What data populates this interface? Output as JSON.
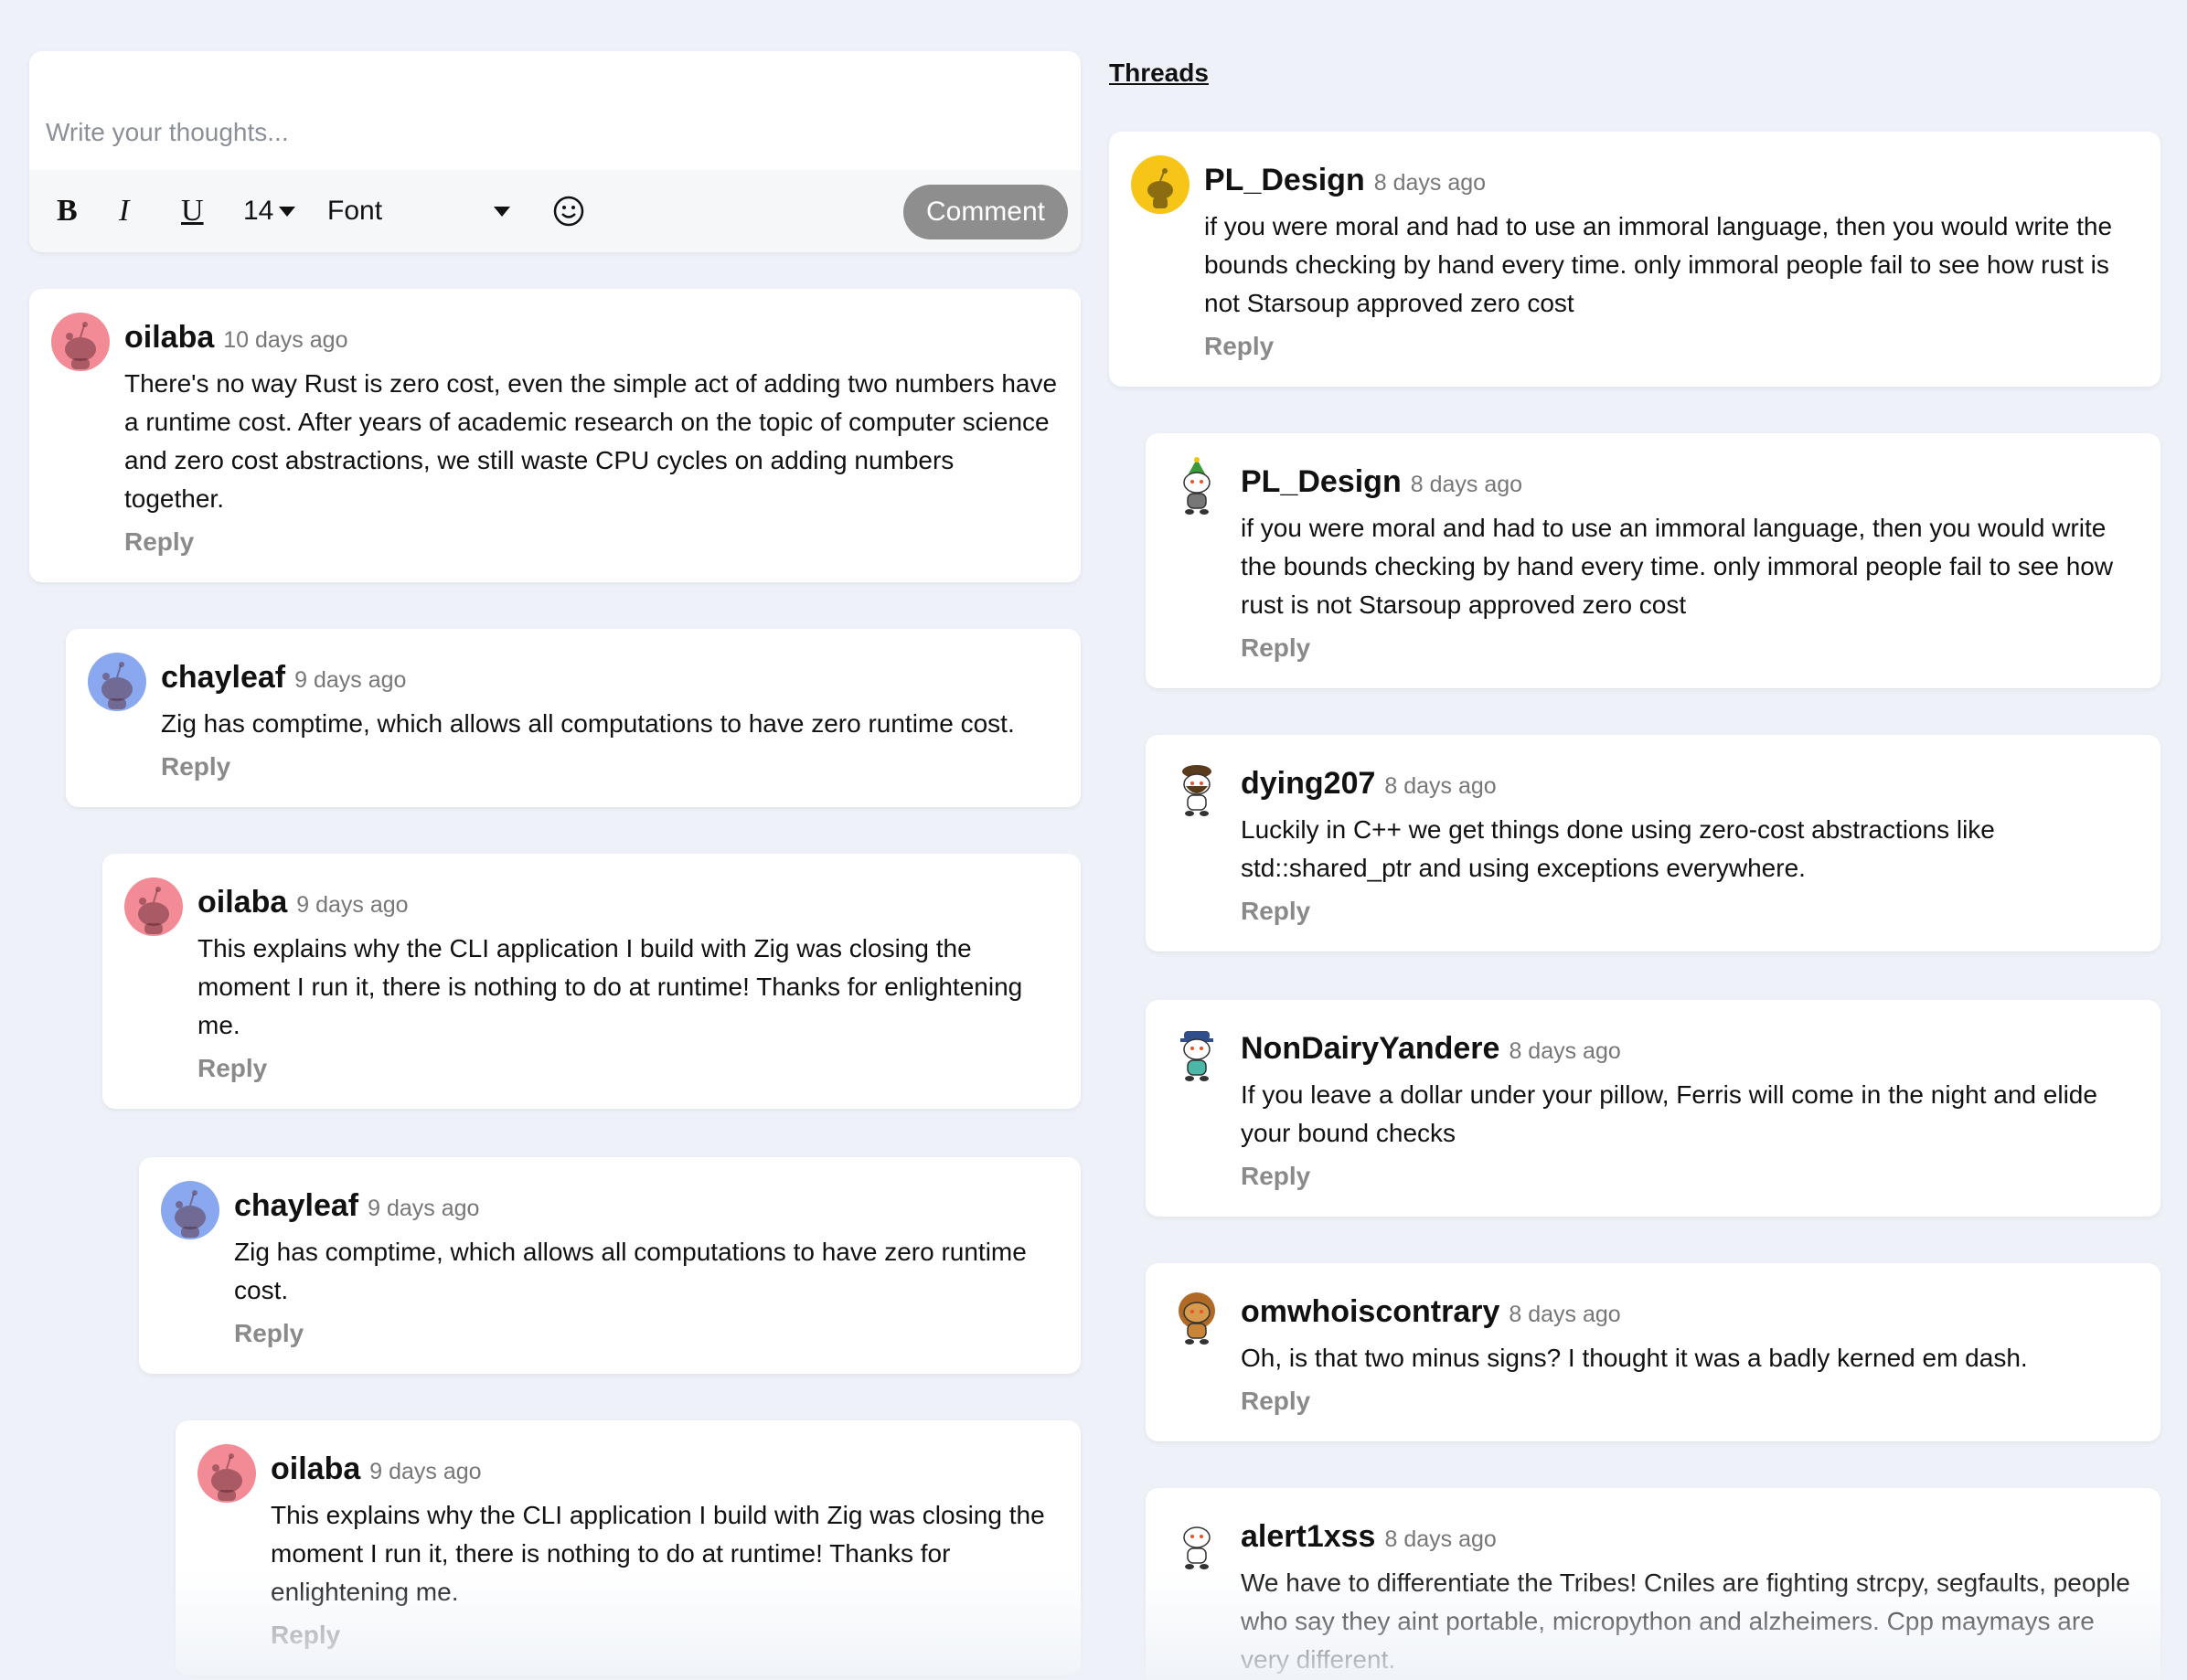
{
  "editor": {
    "placeholder": "Write your thoughts...",
    "bold_label": "B",
    "italic_label": "I",
    "underline_label": "U",
    "font_size": "14",
    "font_label": "Font",
    "comment_label": "Comment"
  },
  "comments": [
    {
      "user": "oilaba",
      "time": "10 days ago",
      "text": "There's no way Rust is zero cost, even the simple act of adding two numbers have a runtime cost. After years of academic research on the topic of computer science and zero cost abstractions, we still waste CPU cycles on adding numbers together.",
      "reply": "Reply",
      "avatar_color": "#f28b95"
    },
    {
      "user": "chayleaf",
      "time": "9 days ago",
      "text": "Zig has comptime, which allows all computations to have zero runtime cost.",
      "reply": "Reply",
      "avatar_color": "#8aa8ef"
    },
    {
      "user": "oilaba",
      "time": "9 days ago",
      "text": "This explains why the CLI application I build with Zig was closing the moment I run it, there is nothing to do at runtime! Thanks for enlightening me.",
      "reply": "Reply",
      "avatar_color": "#f28b95"
    },
    {
      "user": "chayleaf",
      "time": "9 days ago",
      "text": "Zig has comptime, which allows all computations to have zero runtime cost.",
      "reply": "Reply",
      "avatar_color": "#8aa8ef"
    },
    {
      "user": "oilaba",
      "time": "9 days ago",
      "text": "This explains why the CLI application I build with Zig was closing the moment I run it, there is nothing to do at runtime! Thanks for enlightening me.",
      "reply": "Reply",
      "avatar_color": "#f28b95"
    }
  ],
  "threads": {
    "title": "Threads",
    "items": [
      {
        "user": "PL_Design",
        "time": "8 days ago",
        "text": "if you were moral and had to use an immoral language, then you would write the bounds checking by hand every time. only immoral people fail to see how rust is not Starsoup approved zero cost",
        "reply": "Reply",
        "avatar": "snoo-yellow-icon"
      },
      {
        "user": "PL_Design",
        "time": "8 days ago",
        "text": "if you were moral and had to use an immoral language, then you would write the bounds checking by hand every time. only immoral people fail to see how rust is not Starsoup approved zero cost",
        "reply": "Reply",
        "avatar": "snoo-tree-hat-icon"
      },
      {
        "user": "dying207",
        "time": "8 days ago",
        "text": "Luckily in C++ we get things done using zero-cost abstractions like std::shared_ptr and using exceptions everywhere.",
        "reply": "Reply",
        "avatar": "snoo-bearded-icon"
      },
      {
        "user": "NonDairyYandere",
        "time": "8 days ago",
        "text": "If you leave a dollar under your pillow, Ferris will come in the night and elide your bound checks",
        "reply": "Reply",
        "avatar": "snoo-captain-icon"
      },
      {
        "user": "omwhoiscontrary",
        "time": "8 days ago",
        "text": "Oh, is that two minus signs? I thought it was a badly kerned em dash.",
        "reply": "Reply",
        "avatar": "snoo-lion-icon"
      },
      {
        "user": "alert1xss",
        "time": "8 days ago",
        "text": "We have to differentiate the Tribes! Cniles are fighting strcpy, segfaults, people who say they aint portable, micropython and alzheimers. Cpp maymays are very different.",
        "reply": "Reply",
        "avatar": "snoo-default-icon"
      }
    ]
  },
  "colors": {
    "background": "#eef2f8",
    "reply": "#8a8a8a",
    "comment_button": "#8e8e8e",
    "thread_avatar_yellow": "#f6c518"
  }
}
